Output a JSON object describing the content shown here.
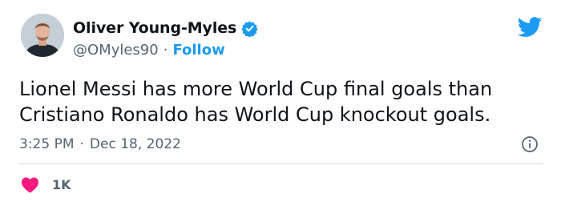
{
  "author": {
    "display_name": "Oliver Young-Myles",
    "handle": "@OMyles90",
    "separator": "·",
    "follow_label": "Follow",
    "verified": true
  },
  "tweet": {
    "line1": "Lionel Messi has more World Cup final goals than",
    "line2": "Cristiano Ronaldo has World Cup knockout goals.",
    "time": "3:25 PM",
    "separator": "·",
    "date": "Dec 18, 2022"
  },
  "engagement": {
    "likes": "1K"
  },
  "icons": {
    "brand": "twitter-bird-icon",
    "verified": "verified-badge-icon",
    "info": "info-icon",
    "like": "heart-icon"
  },
  "colors": {
    "accent": "#1d9bf0",
    "like": "#f91880",
    "text_primary": "#0f1419",
    "text_secondary": "#536471",
    "divider": "#cfd9de"
  }
}
